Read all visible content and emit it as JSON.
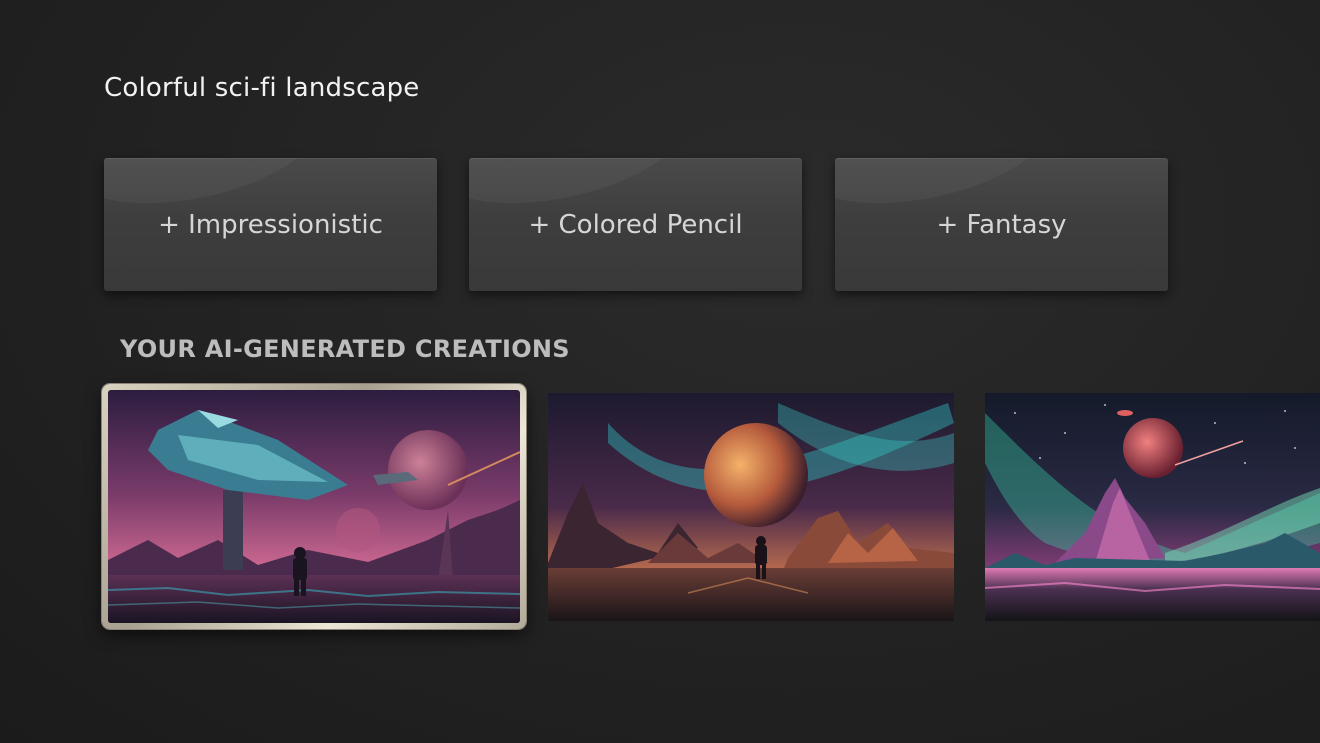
{
  "prompt": {
    "text": "Colorful sci-fi landscape"
  },
  "style_options": [
    {
      "label": "+ Impressionistic"
    },
    {
      "label": "+ Colored Pencil"
    },
    {
      "label": "+ Fantasy"
    }
  ],
  "creations": {
    "heading": "YOUR AI-GENERATED CREATIONS",
    "images": [
      {
        "subject": "spaceship-over-alien-plain",
        "selected": true
      },
      {
        "subject": "planet-over-mountains",
        "selected": false
      },
      {
        "subject": "aurora-over-crystal-peaks",
        "selected": false
      }
    ]
  },
  "colors": {
    "background": "#242424",
    "chip": "#3f3f3f",
    "chip_text": "#d6d6d6",
    "heading_text": "#bdbdbd",
    "focus_border": "#d9d2c0"
  }
}
